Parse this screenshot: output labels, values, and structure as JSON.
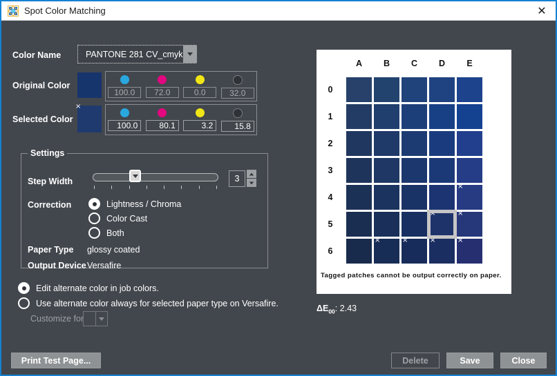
{
  "window": {
    "title": "Spot Color Matching",
    "close_glyph": "✕"
  },
  "colors": {
    "accent_blue": "#1581d2",
    "body_bg": "#42474d",
    "panel_white": "#ffffff",
    "selection_frame": "#c6c6c6",
    "cyan_dot": "#29a8e0",
    "magenta_dot": "#e2087f",
    "yellow_dot": "#f0e616",
    "black_dot": "#2e3337"
  },
  "color_name": {
    "label": "Color Name",
    "value": "PANTONE 281 CV_cmyk",
    "swatch": "#17356d"
  },
  "original": {
    "label": "Original Color",
    "swatch": "#17356d",
    "channels": [
      {
        "name": "cyan",
        "value": "100.0"
      },
      {
        "name": "magenta",
        "value": "72.0"
      },
      {
        "name": "yellow",
        "value": "0.0"
      },
      {
        "name": "black",
        "value": "32.0"
      }
    ]
  },
  "selected": {
    "label": "Selected Color",
    "swatch": "#1f3a6e",
    "tag": "×",
    "channels": [
      {
        "name": "cyan",
        "value": "100.0"
      },
      {
        "name": "magenta",
        "value": "80.1"
      },
      {
        "name": "yellow",
        "value": "3.2"
      },
      {
        "name": "black",
        "value": "15.8"
      }
    ]
  },
  "settings": {
    "title": "Settings",
    "step_width": {
      "label": "Step Width",
      "value": "3",
      "thumb_percent": 34
    },
    "correction": {
      "label": "Correction",
      "options": [
        {
          "label": "Lightness / Chroma",
          "selected": true
        },
        {
          "label": "Color Cast",
          "selected": false
        },
        {
          "label": "Both",
          "selected": false
        }
      ]
    },
    "paper_type": {
      "label": "Paper Type",
      "value": "glossy coated"
    },
    "output_device": {
      "label": "Output Device",
      "value": "Versafire"
    }
  },
  "alternate": {
    "options": [
      {
        "label": "Edit alternate color in job colors.",
        "selected": true
      },
      {
        "label": "Use alternate color always for selected paper type on Versafire.",
        "selected": false
      }
    ],
    "customize_label": "Customize for"
  },
  "patch_grid": {
    "columns": [
      "A",
      "B",
      "C",
      "D",
      "E"
    ],
    "rows": [
      "0",
      "1",
      "2",
      "3",
      "4",
      "5",
      "6"
    ],
    "selected": "D5",
    "tagged": [
      "E4",
      "D5",
      "E5",
      "B6",
      "C6",
      "D6",
      "E6"
    ],
    "tag_glyph": "×",
    "patches": [
      [
        "#27416b",
        "#23436f",
        "#1f437a",
        "#1f4380",
        "#1c438c"
      ],
      [
        "#233c65",
        "#203e6e",
        "#1d3f79",
        "#184085",
        "#144190"
      ],
      [
        "#203760",
        "#1f3a69",
        "#1c3b73",
        "#1a3c7e",
        "#223f8d"
      ],
      [
        "#1e345b",
        "#1e3764",
        "#1c376e",
        "#1c3977",
        "#253c86"
      ],
      [
        "#1c3156",
        "#1b335f",
        "#1a3367",
        "#1c3572",
        "#273b83"
      ],
      [
        "#1a2e51",
        "#1a305a",
        "#183061",
        "#1f336b",
        "#27387a"
      ],
      [
        "#182b4c",
        "#182d55",
        "#172c5a",
        "#1b2e62",
        "#262f70"
      ]
    ],
    "note": "Tagged patches cannot be output correctly on paper."
  },
  "delta_e": {
    "label": "ΔE",
    "sub": "00",
    "separator": ":",
    "value": "2.43"
  },
  "buttons": {
    "print_test_page": "Print Test Page...",
    "delete": "Delete",
    "save": "Save",
    "close": "Close"
  }
}
